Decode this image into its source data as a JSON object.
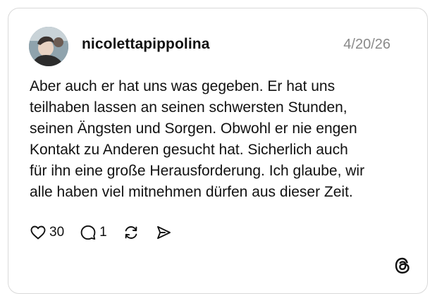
{
  "post": {
    "username": "nicolettapippolina",
    "date": "4/20/26",
    "text": "Aber auch er hat uns was gegeben. Er hat uns\nteilhaben lassen an seinen schwersten Stunden,\nseinen Ängsten und Sorgen. Obwohl er nie engen\nKontakt zu Anderen gesucht hat. Sicherlich auch\nfür ihn eine große Herausforderung. Ich glaube, wir\nalle haben viel mitnehmen dürfen aus dieser Zeit.",
    "likes": "30",
    "replies": "1"
  },
  "icons": {
    "like": "heart-icon",
    "reply": "speech-bubble-icon",
    "repost": "repost-icon",
    "share": "send-icon",
    "brand": "threads-logo-icon"
  }
}
